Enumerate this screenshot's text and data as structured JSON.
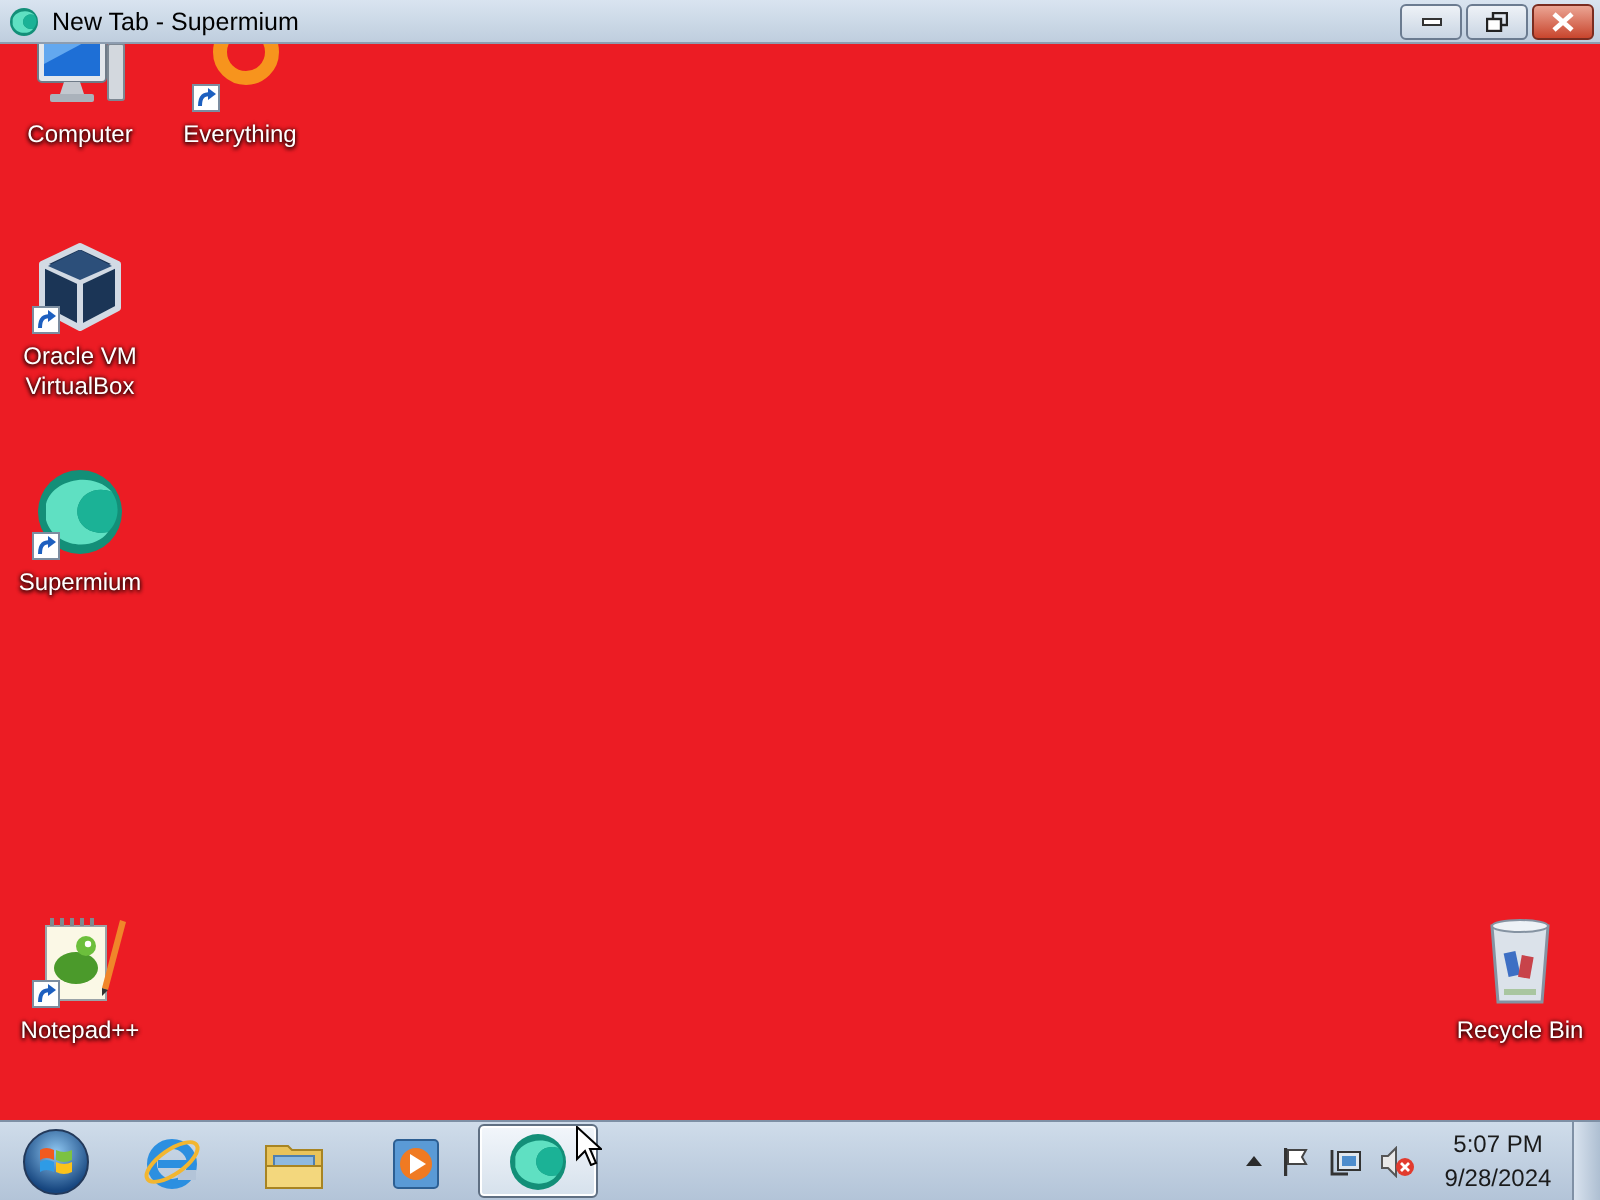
{
  "window": {
    "title": "New Tab - Supermium",
    "buttons": [
      {
        "kind": "minimize"
      },
      {
        "kind": "restore"
      },
      {
        "kind": "close"
      }
    ]
  },
  "desktop_icons": [
    {
      "kind": "computer",
      "label": "Computer",
      "shortcut": false
    },
    {
      "kind": "everything",
      "label": "Everything",
      "shortcut": true
    },
    {
      "kind": "virtualbox",
      "label": "Oracle VM VirtualBox",
      "shortcut": true
    },
    {
      "kind": "supermium",
      "label": "Supermium",
      "shortcut": true
    },
    {
      "kind": "notepadpp",
      "label": "Notepad++",
      "shortcut": true
    },
    {
      "kind": "recycle_bin",
      "label": "Recycle Bin",
      "shortcut": false
    }
  ],
  "taskbar": {
    "items": [
      {
        "kind": "ie",
        "selected": false
      },
      {
        "kind": "explorer",
        "selected": false
      },
      {
        "kind": "media_player",
        "selected": false
      },
      {
        "kind": "supermium",
        "selected": true
      }
    ],
    "tray": [
      {
        "kind": "show_hidden"
      },
      {
        "kind": "action_center"
      },
      {
        "kind": "network"
      },
      {
        "kind": "volume",
        "muted": true
      }
    ],
    "clock": {
      "time": "5:07 PM",
      "date": "9/28/2024"
    }
  }
}
